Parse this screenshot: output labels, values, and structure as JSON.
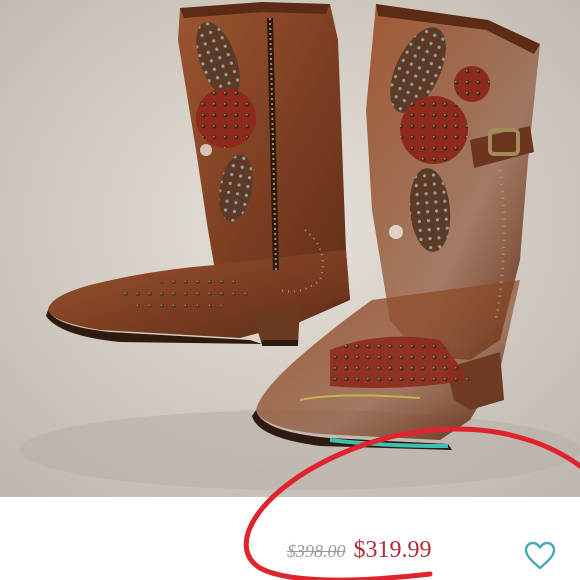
{
  "listing": {
    "image_subject": "boots-photo",
    "original_price": "$398.00",
    "sale_price": "$319.99",
    "like_icon": "heart-outline-icon"
  },
  "colors": {
    "backdrop": "#ddd7cf",
    "leather": "#8a4a2a",
    "leather_dark": "#5a2d18",
    "sole_accent": "#3fbfb3",
    "sale_price": "#b32a33",
    "old_price": "#9a9a9a",
    "annotation_stroke": "#e0242e",
    "like_icon": "#4aa7b7"
  }
}
